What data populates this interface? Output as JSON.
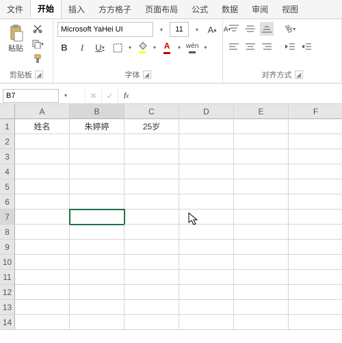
{
  "tabs": [
    "文件",
    "开始",
    "插入",
    "方方格子",
    "页面布局",
    "公式",
    "数据",
    "审阅",
    "视图"
  ],
  "activeTab": 1,
  "ribbon": {
    "clipboard": {
      "label": "剪贴板",
      "paste": "粘贴"
    },
    "font": {
      "label": "字体",
      "family": "Microsoft YaHei UI",
      "size": "11",
      "bold": "B",
      "italic": "I",
      "underline": "U",
      "pinyin": "wén"
    },
    "align": {
      "label": "对齐方式"
    }
  },
  "nameBox": "B7",
  "formula": "",
  "columns": [
    "A",
    "B",
    "C",
    "D",
    "E",
    "F"
  ],
  "rows": 14,
  "selection": {
    "row": 7,
    "col": "B"
  },
  "cells": {
    "A1": "姓名",
    "B1": "朱婷婷",
    "C1": "25岁"
  }
}
